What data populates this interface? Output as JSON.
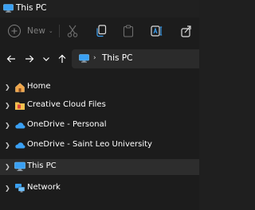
{
  "window": {
    "title": "This PC",
    "title_icon": "monitor-icon"
  },
  "toolbar": {
    "new_label": "New",
    "buttons": [
      {
        "name": "cut",
        "icon": "scissors-icon",
        "enabled": false
      },
      {
        "name": "copy",
        "icon": "copy-icon",
        "enabled": true
      },
      {
        "name": "paste",
        "icon": "clipboard-icon",
        "enabled": false
      },
      {
        "name": "rename",
        "icon": "rename-icon",
        "enabled": true
      },
      {
        "name": "share",
        "icon": "share-icon",
        "enabled": true
      }
    ]
  },
  "nav": {
    "back_icon": "arrow-left-icon",
    "forward_icon": "arrow-right-icon",
    "recent_icon": "chevron-down-icon",
    "up_icon": "arrow-up-icon"
  },
  "address": {
    "icon": "monitor-icon",
    "path": "This PC"
  },
  "sidebar": {
    "items": [
      {
        "label": "Home",
        "icon": "home-icon",
        "selected": false
      },
      {
        "label": "Creative Cloud Files",
        "icon": "folder-icon",
        "selected": false
      },
      {
        "label": "OneDrive - Personal",
        "icon": "cloud-icon",
        "selected": false
      },
      {
        "label": "OneDrive - Saint Leo University",
        "icon": "cloud-icon",
        "selected": false
      },
      {
        "label": "This PC",
        "icon": "monitor-icon",
        "selected": true
      },
      {
        "label": "Network",
        "icon": "network-icon",
        "selected": false
      }
    ]
  },
  "colors": {
    "background": "#1c1c1c",
    "selected": "#2d2d2d",
    "address_bg": "#2b2b2b",
    "accent": "#3aa0f3"
  }
}
